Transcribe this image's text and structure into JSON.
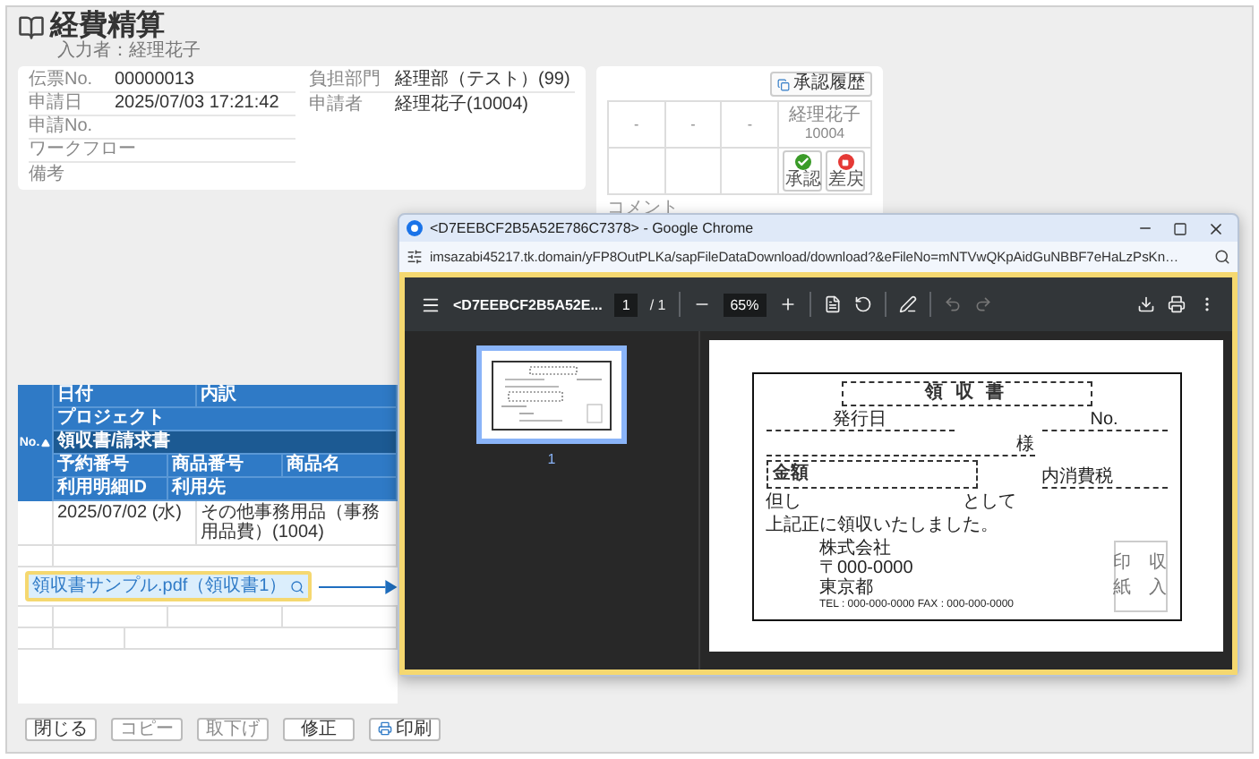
{
  "page": {
    "title": "経費精算",
    "subtitle": "入力者：経理花子"
  },
  "info": {
    "left": [
      {
        "label": "伝票No.",
        "value": "00000013"
      },
      {
        "label": "申請日",
        "value": "2025/07/03 17:21:42"
      },
      {
        "label": "申請No."
      },
      {
        "label": "ワークフロー"
      },
      {
        "label": "備考"
      }
    ],
    "right": [
      {
        "label": "負担部門",
        "value": "経理部（テスト）(99)"
      },
      {
        "label": "申請者",
        "value": "経理花子(10004)"
      }
    ]
  },
  "approval": {
    "history_button": "承認履歴",
    "comment_label": "コメント",
    "approvers": [
      {
        "name": "-"
      },
      {
        "name": "-"
      },
      {
        "name": "-"
      },
      {
        "name": "経理花子",
        "code": "10004",
        "actions": [
          {
            "kind": "approve",
            "label": "承認"
          },
          {
            "kind": "reject",
            "label": "差戻"
          }
        ]
      }
    ]
  },
  "table": {
    "no_header": "No.",
    "header_rows": [
      {
        "kind": "plain",
        "cells": [
          "日付",
          "内訳"
        ]
      },
      {
        "kind": "plain",
        "cells": [
          "プロジェクト"
        ]
      },
      {
        "kind": "section",
        "cells": [
          "領収書/請求書"
        ]
      },
      {
        "kind": "small",
        "cells": [
          "予約番号",
          "商品番号",
          "商品名"
        ]
      },
      {
        "kind": "small",
        "cells": [
          "利用明細ID",
          "利用先"
        ]
      }
    ],
    "rows": [
      {
        "date": "2025/07/02 (水)",
        "detail": "その他事務用品（事務用品費）(1004)",
        "attachment": "領収書サンプル.pdf（領収書1）"
      }
    ]
  },
  "footer_buttons": [
    {
      "kind": "plain",
      "label": "閉じる",
      "disabled": false
    },
    {
      "kind": "plain",
      "label": "コピー",
      "disabled": true
    },
    {
      "kind": "plain",
      "label": "取下げ",
      "disabled": true
    },
    {
      "kind": "plain",
      "label": "修正",
      "disabled": false
    },
    {
      "kind": "print",
      "label": "印刷",
      "disabled": false
    }
  ],
  "chrome": {
    "title": "<D7EEBCF2B5A52E786C7378> - Google Chrome",
    "url": "imsazabi45217.tk.domain/yFP8OutPLKa/sapFileDataDownload/download?&eFileNo=mNTVwQKpAidGuNBBF7eHaLzPsKn…",
    "pdf": {
      "file": "<D7EEBCF2B5A52E...",
      "page": "1",
      "pages": "/ 1",
      "zoom": "65%",
      "thumbnails": [
        {
          "label": "1",
          "selected": true
        }
      ]
    },
    "receipt": {
      "title": "領 収 書",
      "issue_date_label": "発行日",
      "no_label": "No.",
      "addressee_suffix": "様",
      "amount_label": "金額",
      "tax_label": "内消費税",
      "purpose_prefix": "但し",
      "purpose_suffix": "として",
      "statement": "上記正に領収いたしました。",
      "issuer": [
        "株式会社",
        "〒000-0000",
        "東京都",
        "TEL : 000-000-0000  FAX : 000-000-0000"
      ],
      "stamp": [
        "印　収",
        "紙　入"
      ]
    }
  }
}
